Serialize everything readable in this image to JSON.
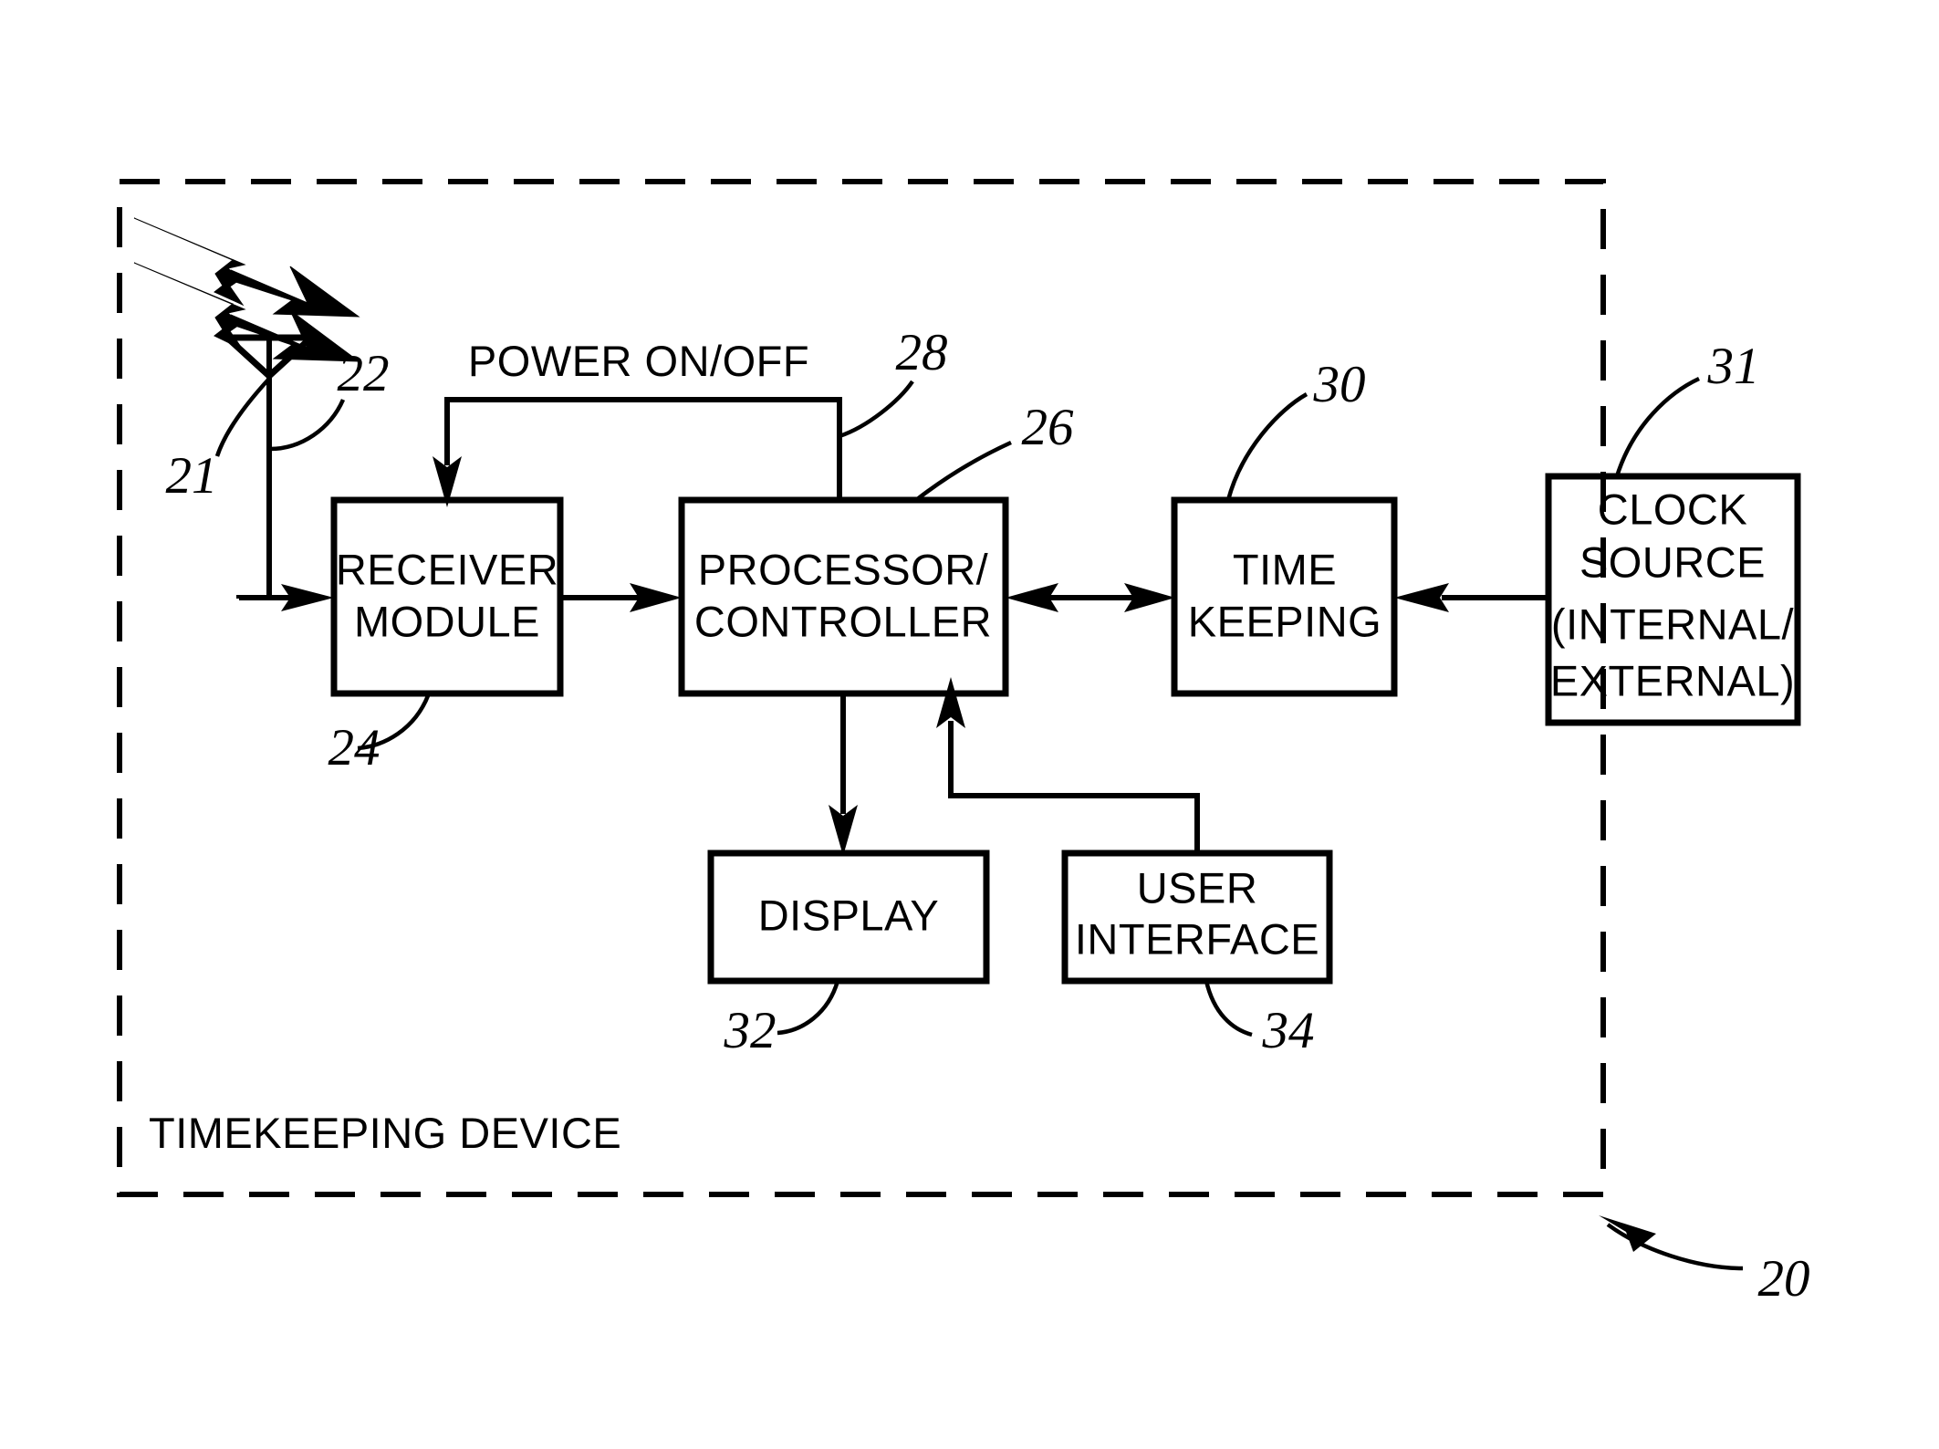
{
  "figure": {
    "outer_container_label": "TIMEKEEPING DEVICE",
    "outer_reference": "20"
  },
  "blocks": [
    {
      "id": "receiver",
      "lines": [
        "RECEIVER",
        "MODULE"
      ],
      "reference": "24"
    },
    {
      "id": "processor",
      "lines": [
        "PROCESSOR/",
        "CONTROLLER"
      ],
      "reference": "26"
    },
    {
      "id": "timekeeping",
      "lines": [
        "TIME",
        "KEEPING"
      ],
      "reference": "30"
    },
    {
      "id": "clocksource",
      "lines": [
        "CLOCK",
        "SOURCE",
        "(INTERNAL/",
        "EXTERNAL)"
      ],
      "reference": "31"
    },
    {
      "id": "display",
      "lines": [
        "DISPLAY"
      ],
      "reference": "32"
    },
    {
      "id": "userinterface",
      "lines": [
        "USER",
        "INTERFACE"
      ],
      "reference": "34"
    }
  ],
  "antenna": {
    "signal_reference": "21",
    "antenna_reference": "22"
  },
  "signals": {
    "power_on_off_label": "POWER ON/OFF",
    "power_on_off_reference": "28"
  },
  "colors": {
    "ink": "#000000",
    "paper": "#ffffff"
  }
}
